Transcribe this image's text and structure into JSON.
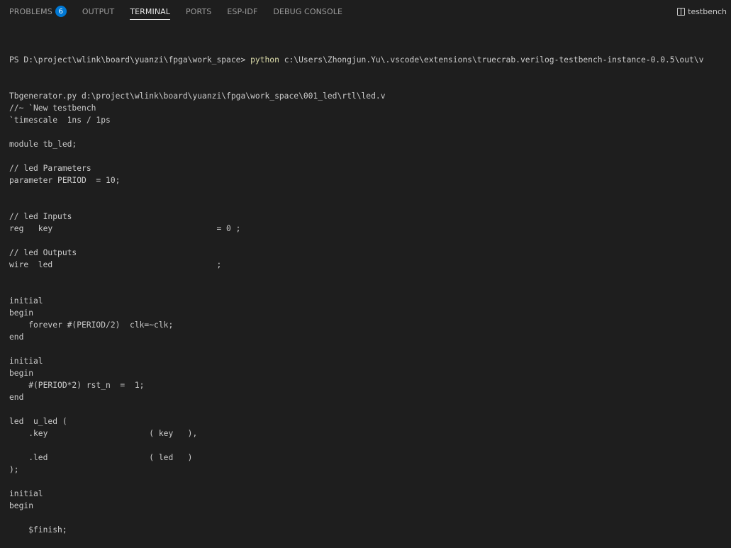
{
  "panel": {
    "tabs": [
      {
        "label": "PROBLEMS",
        "badge": "6"
      },
      {
        "label": "OUTPUT"
      },
      {
        "label": "TERMINAL"
      },
      {
        "label": "PORTS"
      },
      {
        "label": "ESP-IDF"
      },
      {
        "label": "DEBUG CONSOLE"
      }
    ],
    "terminal_name": "testbench"
  },
  "terminal": {
    "prompt": "PS D:\\project\\wlink\\board\\yuanzi\\fpga\\work_space> ",
    "command": "python",
    "args_line1": " c:\\Users\\Zhongjun.Yu\\.vscode\\extensions\\truecrab.verilog-testbench-instance-0.0.5\\out\\v",
    "lines": [
      "Tbgenerator.py d:\\project\\wlink\\board\\yuanzi\\fpga\\work_space\\001_led\\rtl\\led.v",
      "//~ `New testbench",
      "`timescale  1ns / 1ps",
      "",
      "module tb_led;",
      "",
      "// led Parameters",
      "parameter PERIOD  = 10;",
      "",
      "",
      "// led Inputs",
      "reg   key                                  = 0 ;",
      "",
      "// led Outputs",
      "wire  led                                  ;",
      "",
      "",
      "initial",
      "begin",
      "    forever #(PERIOD/2)  clk=~clk;",
      "end",
      "",
      "initial",
      "begin",
      "    #(PERIOD*2) rst_n  =  1;",
      "end",
      "",
      "led  u_led (",
      "    .key                     ( key   ),",
      "",
      "    .led                     ( led   )",
      ");",
      "",
      "initial",
      "begin",
      "",
      "    $finish;"
    ]
  }
}
